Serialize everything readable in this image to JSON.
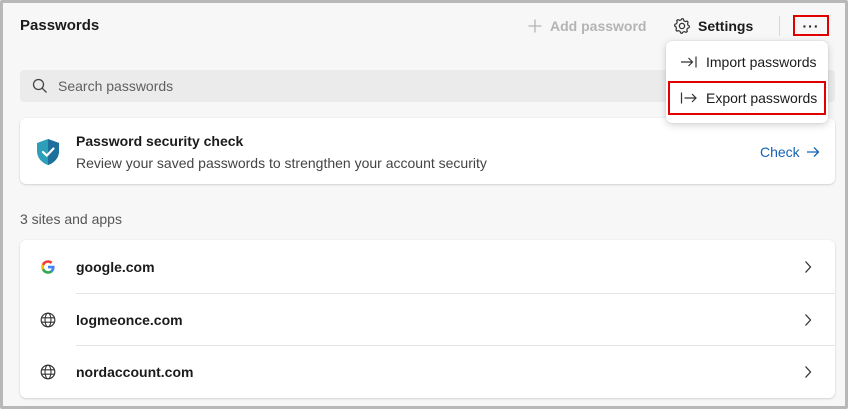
{
  "header": {
    "title": "Passwords",
    "add_password_label": "Add password",
    "settings_label": "Settings",
    "more_label": "···"
  },
  "search": {
    "placeholder": "Search passwords"
  },
  "security_check": {
    "title": "Password security check",
    "description": "Review your saved passwords to strengthen your account security",
    "action_label": "Check"
  },
  "sites": {
    "count_label": "3 sites and apps",
    "items": [
      {
        "name": "google.com",
        "icon": "google-icon"
      },
      {
        "name": "logmeonce.com",
        "icon": "globe-icon"
      },
      {
        "name": "nordaccount.com",
        "icon": "globe-icon"
      }
    ]
  },
  "more_menu": {
    "items": [
      {
        "label": "Import passwords",
        "icon": "import-icon"
      },
      {
        "label": "Export passwords",
        "icon": "export-icon"
      }
    ]
  },
  "colors": {
    "accent": "#1463b3",
    "highlight": "#e00000",
    "background": "#f7f7f7",
    "card": "#ffffff"
  }
}
